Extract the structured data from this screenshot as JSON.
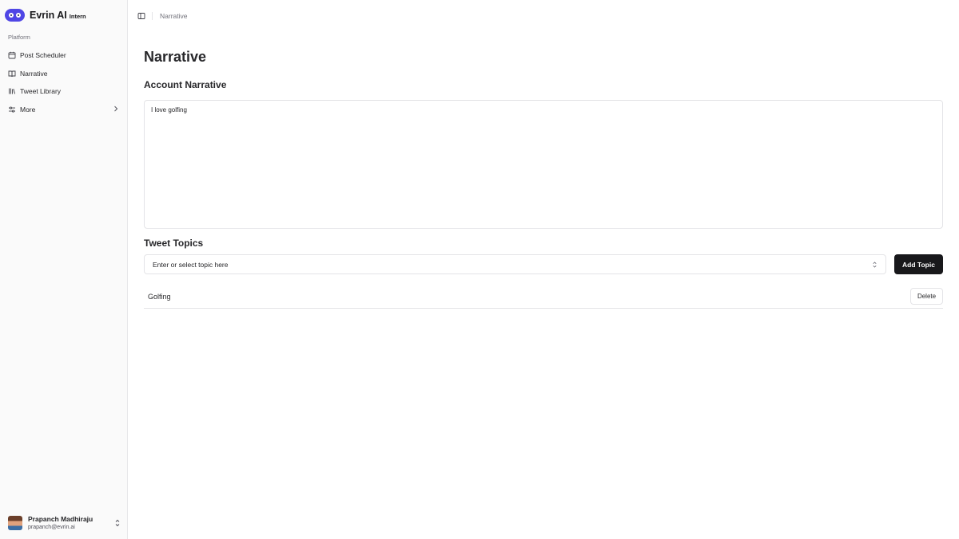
{
  "sidebar": {
    "brand": {
      "name": "Evrin AI",
      "badge": "Intern",
      "logo_color": "#4f46e5"
    },
    "group_label": "Platform",
    "items": [
      {
        "label": "Post Scheduler",
        "icon": "calendar-icon"
      },
      {
        "label": "Narrative",
        "icon": "book-open-icon"
      },
      {
        "label": "Tweet Library",
        "icon": "library-icon"
      },
      {
        "label": "More",
        "icon": "settings-sliders-icon",
        "has_chevron": true
      }
    ],
    "user": {
      "name": "Prapanch Madhiraju",
      "email": "prapanch@evrin.ai"
    }
  },
  "header": {
    "breadcrumb": "Narrative"
  },
  "main": {
    "title": "Narrative",
    "account_narrative": {
      "heading": "Account Narrative",
      "value": "I love golfing"
    },
    "tweet_topics": {
      "heading": "Tweet Topics",
      "placeholder": "Enter or select topic here",
      "add_label": "Add Topic",
      "topics": [
        {
          "name": "Golfing",
          "delete_label": "Delete"
        }
      ]
    }
  },
  "colors": {
    "primary_button": "#18181b",
    "sidebar_bg": "#fafafa",
    "border": "#e4e4e7"
  }
}
